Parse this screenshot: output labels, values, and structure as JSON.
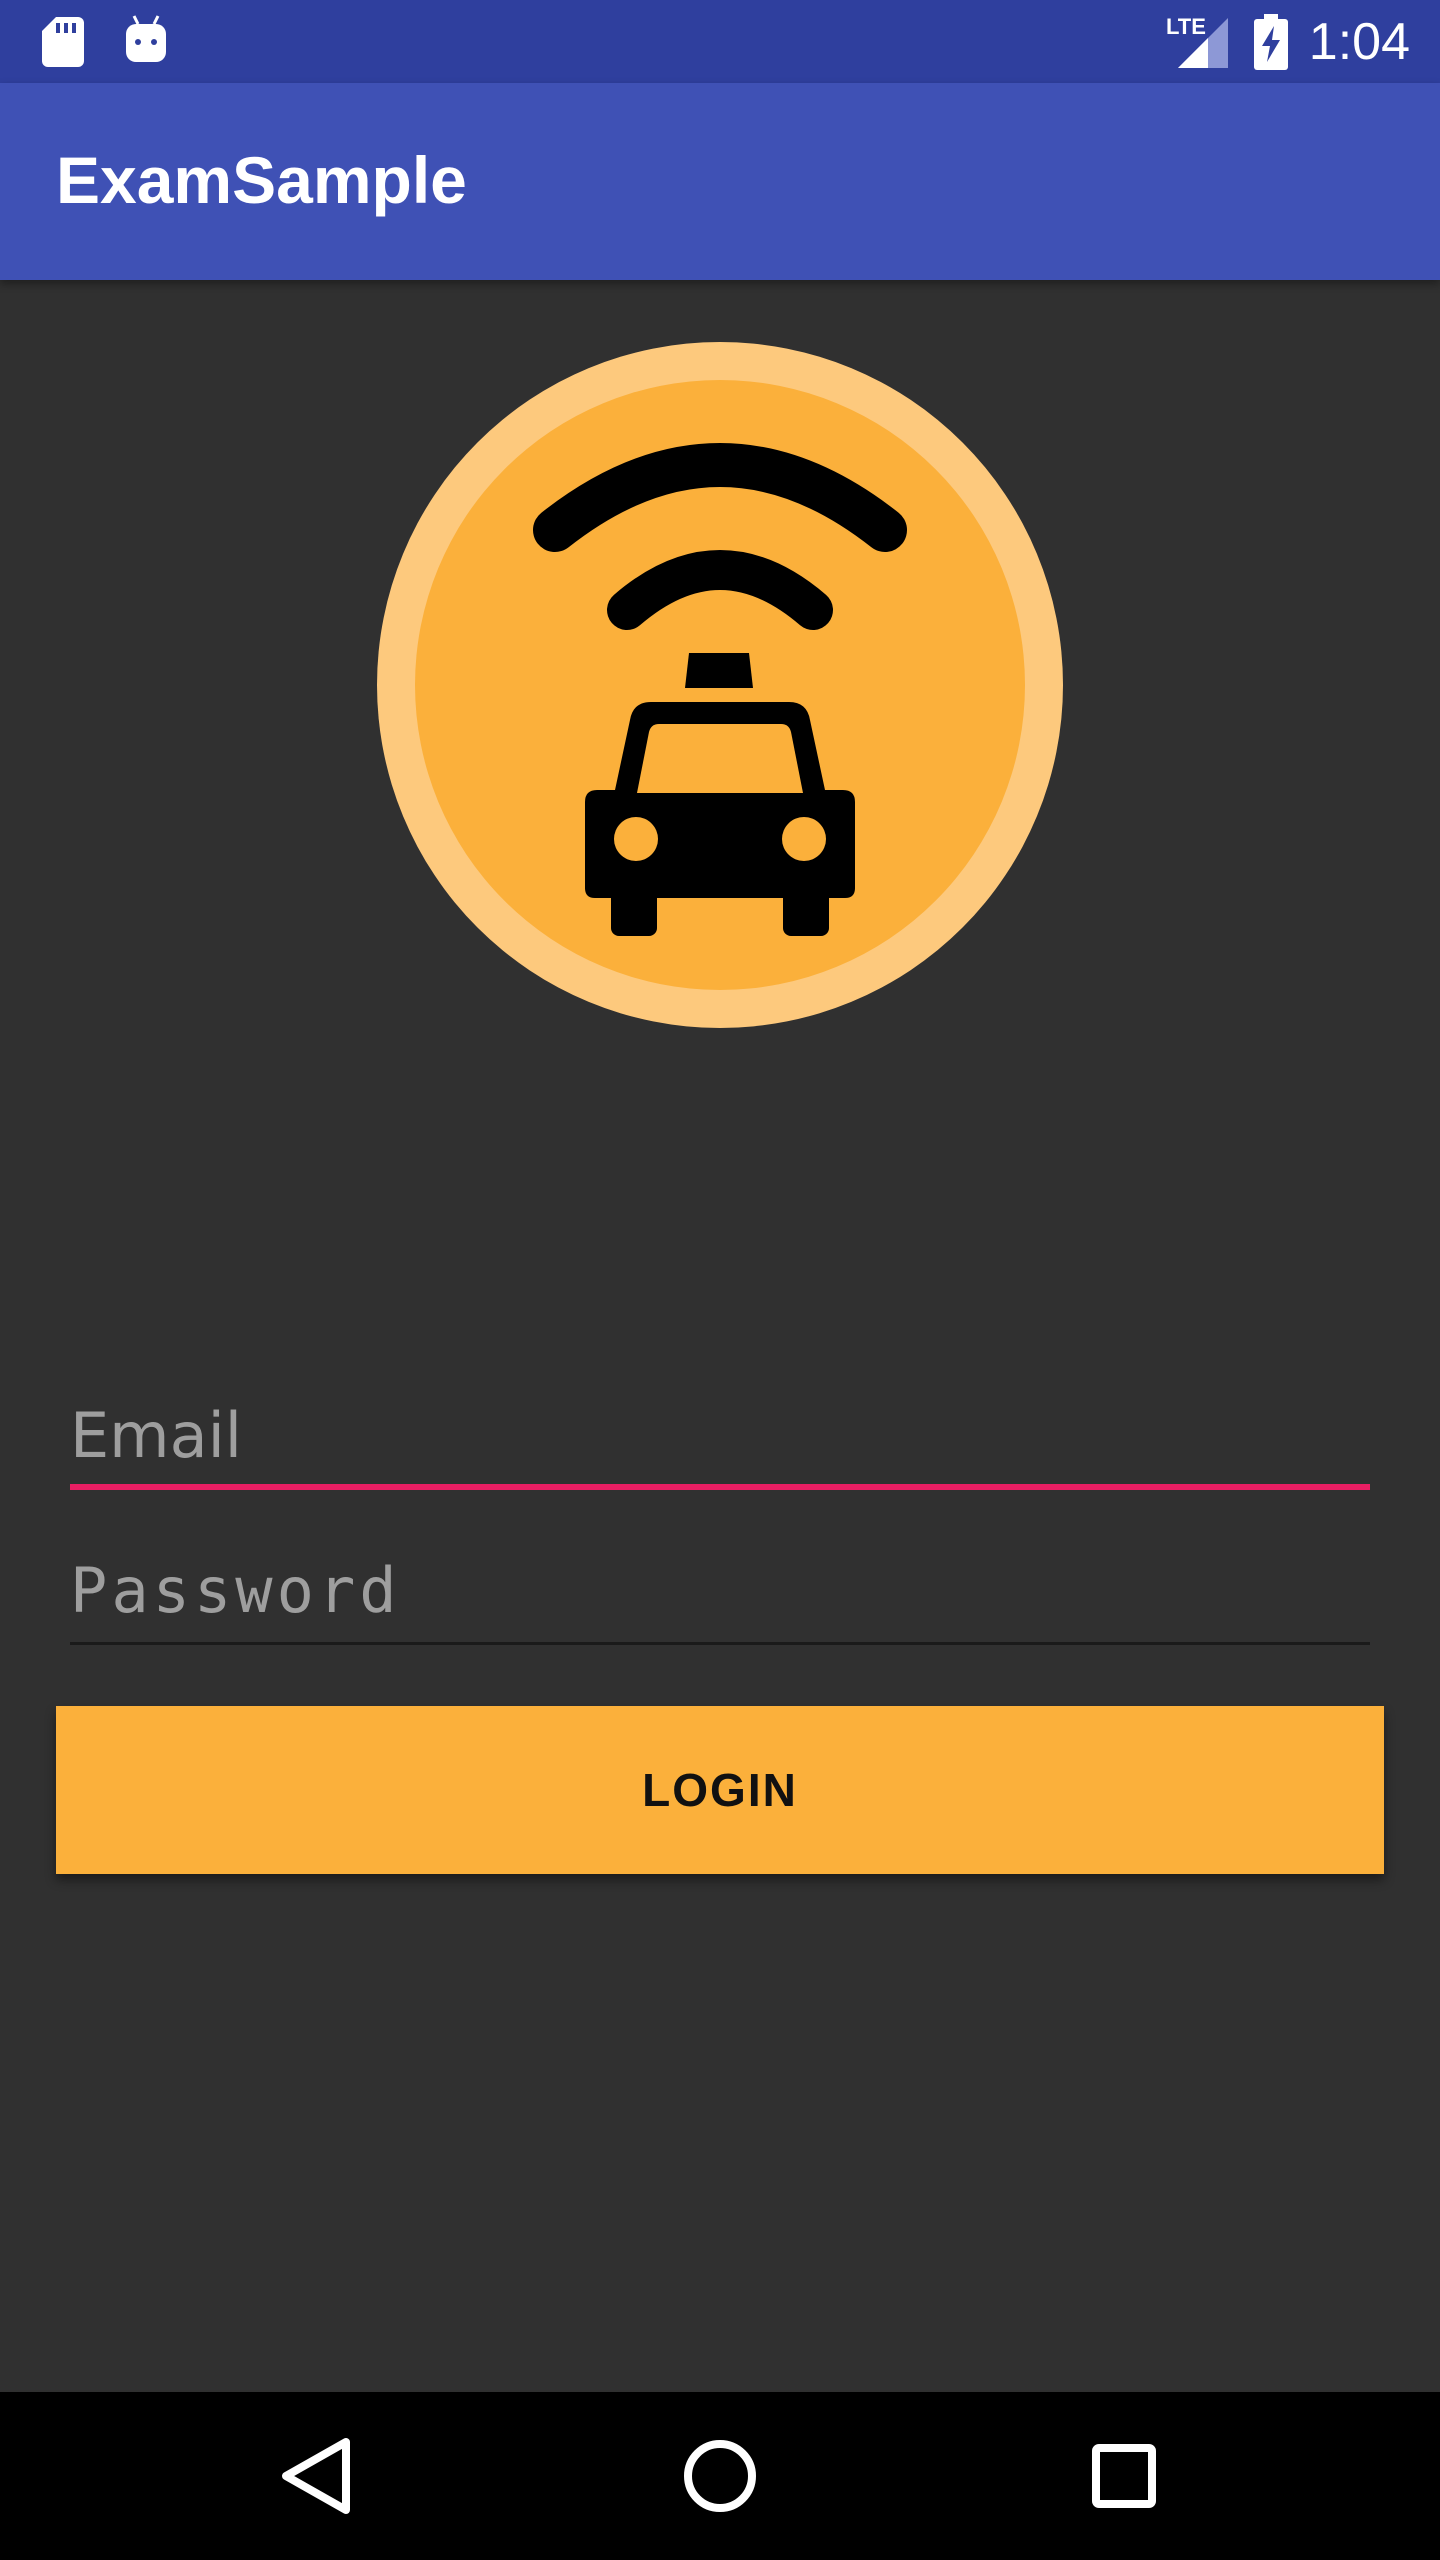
{
  "status_bar": {
    "time": "1:04",
    "network": "LTE",
    "icons": [
      "sd-card-icon",
      "android-icon",
      "lte-signal-icon",
      "battery-charging-icon"
    ]
  },
  "app_bar": {
    "title": "ExamSample"
  },
  "logo": {
    "icon": "taxi-signal-logo-icon",
    "outer_color": "#fdc97d",
    "inner_color": "#fbb03b"
  },
  "login_form": {
    "email": {
      "placeholder": "Email",
      "value": ""
    },
    "password": {
      "placeholder": "Password",
      "value": ""
    },
    "login_button_label": "LOGIN"
  },
  "colors": {
    "status_bar": "#2f3f9e",
    "app_bar": "#3f51b5",
    "background": "#303030",
    "accent": "#e91e63",
    "button": "#fbb03b"
  },
  "nav_bar": {
    "buttons": [
      "back-icon",
      "home-icon",
      "recents-icon"
    ]
  }
}
